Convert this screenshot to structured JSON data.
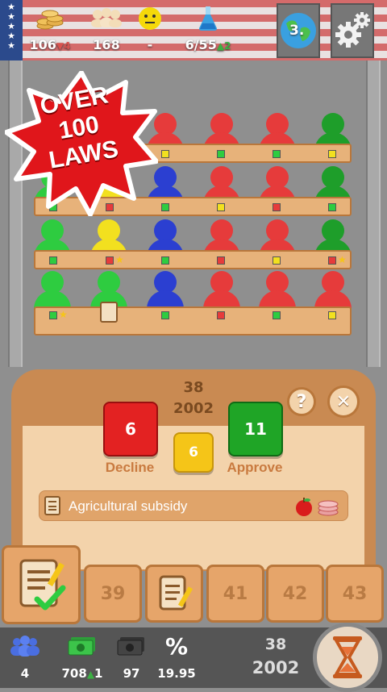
{
  "topbar": {
    "money": {
      "value": "106",
      "change": "4"
    },
    "population": {
      "value": "168"
    },
    "happiness": {
      "value": "-"
    },
    "research": {
      "value": "6/55",
      "change": "2"
    },
    "world_rank": "3.",
    "icons": {
      "money": "coins-icon",
      "population": "people-icon",
      "happiness": "neutral-face-icon",
      "research": "flask-icon",
      "globe": "globe-icon",
      "settings": "gear-icon"
    }
  },
  "badge": {
    "line1": "OVER",
    "line2": "100",
    "line3": "LAWS"
  },
  "colors": {
    "red": "#e63b3b",
    "green": "#2ecc40",
    "dark_green": "#1e9e2a",
    "blue": "#2b3fd1",
    "yellow": "#f2e01f",
    "wood": "#e7b27a",
    "panel": "#c98a52",
    "panel_inner": "#f3d3ab"
  },
  "vote_panel": {
    "law_number": "38",
    "year": "2002",
    "decline": {
      "count": "6",
      "label": "Decline"
    },
    "abstain": {
      "count": "6"
    },
    "approve": {
      "count": "11",
      "label": "Approve"
    },
    "help_label": "?",
    "close_label": "✕",
    "law_title": "Agricultural subsidy",
    "law_icons": [
      "apple-icon",
      "coins-icon"
    ]
  },
  "tabs": [
    {
      "label": "",
      "icon": "document-check-icon"
    },
    {
      "label": "39"
    },
    {
      "label": "",
      "icon": "document-pencil-icon"
    },
    {
      "label": "41"
    },
    {
      "label": "42"
    },
    {
      "label": "43"
    }
  ],
  "bottombar": {
    "seats": "4",
    "budget": {
      "value": "708",
      "change": "1"
    },
    "debt": "97",
    "rate": "19.95",
    "turn": {
      "number": "38",
      "year": "2002"
    },
    "icons": {
      "seats": "people-icon",
      "budget": "banknote-icon",
      "debt": "dark-banknote-icon",
      "rate": "percent-icon",
      "next_turn": "hourglass-icon"
    }
  }
}
